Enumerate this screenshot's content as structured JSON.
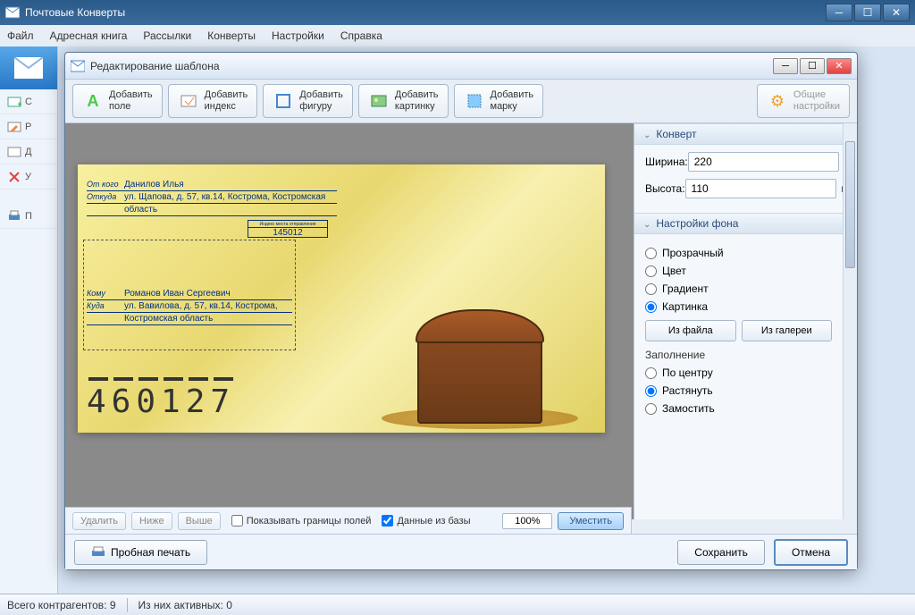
{
  "app": {
    "title": "Почтовые Конверты"
  },
  "menubar": [
    "Файл",
    "Адресная книга",
    "Рассылки",
    "Конверты",
    "Настройки",
    "Справка"
  ],
  "sidebar": {
    "items": [
      {
        "label": "С"
      },
      {
        "label": "Р"
      },
      {
        "label": "Д"
      },
      {
        "label": "У"
      },
      {
        "label": "П"
      }
    ]
  },
  "dialog": {
    "title": "Редактирование шаблона",
    "toolbar": {
      "add_field": "Добавить\nполе",
      "add_index": "Добавить\nиндекс",
      "add_shape": "Добавить\nфигуру",
      "add_image": "Добавить\nкартинку",
      "add_stamp": "Добавить\nмарку",
      "settings": "Общие\nнастройки"
    },
    "envelope": {
      "from_lbl": "От кого",
      "from_val": "Данилов Илья",
      "from_addr_lbl": "Откуда",
      "from_addr_val": "ул. Щапова, д. 57, кв.14, Кострома, Костромская",
      "from_addr_val2": "область",
      "index_box_hdr": "Индекс места отправления",
      "index_box_val": "145012",
      "to_lbl": "Кому",
      "to_val": "Романов Иван Сергеевич",
      "to_addr_lbl": "Куда",
      "to_addr_val": "ул. Вавилова, д. 57, кв.14, Кострома,",
      "to_addr_val2": "Костромская область",
      "postindex": "460127"
    },
    "panel": {
      "sec_envelope": "Конверт",
      "width_lbl": "Ширина:",
      "width_val": "220",
      "height_lbl": "Высота:",
      "height_val": "110",
      "unit": "мм",
      "sec_bg": "Настройки фона",
      "opt_transparent": "Прозрачный",
      "opt_color": "Цвет",
      "opt_gradient": "Градиент",
      "opt_image": "Картинка",
      "btn_fromfile": "Из файла",
      "btn_fromgallery": "Из галереи",
      "fill_lbl": "Заполнение",
      "fill_center": "По центру",
      "fill_stretch": "Растянуть",
      "fill_tile": "Замостить"
    },
    "bottom": {
      "delete": "Удалить",
      "lower": "Ниже",
      "higher": "Выше",
      "show_borders": "Показывать границы полей",
      "db_data": "Данные из базы",
      "zoom": "100%",
      "fit": "Уместить"
    },
    "footer": {
      "preview": "Пробная печать",
      "save": "Сохранить",
      "cancel": "Отмена"
    }
  },
  "status": {
    "total_lbl": "Всего контрагентов: ",
    "total_val": "9",
    "active_lbl": "Из них активных: ",
    "active_val": "0"
  }
}
